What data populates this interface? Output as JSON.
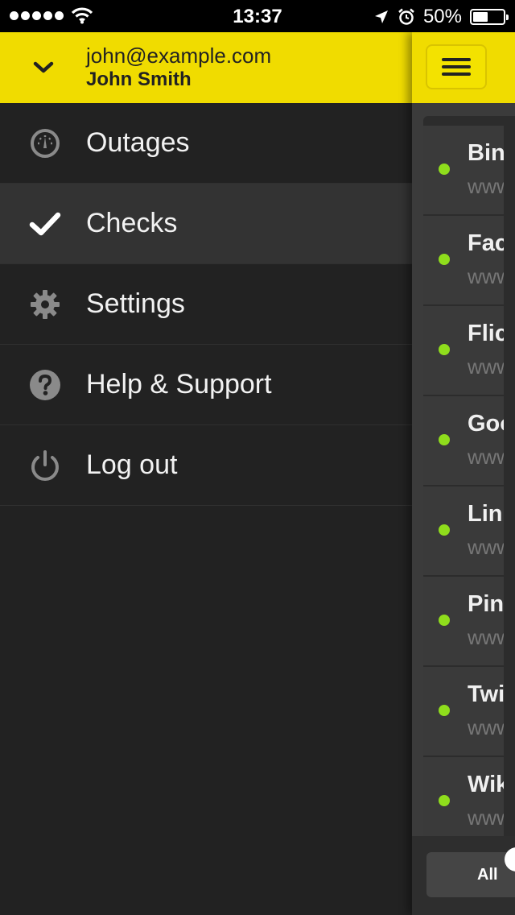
{
  "status_bar": {
    "time": "13:37",
    "battery": "50%",
    "icons": [
      "signal-dots",
      "wifi-icon",
      "location-arrow-icon",
      "alarm-icon",
      "battery-icon"
    ]
  },
  "drawer": {
    "account": {
      "email": "john@example.com",
      "name": "John Smith",
      "icon": "chevron-down-icon"
    },
    "menu": [
      {
        "label": "Outages",
        "icon": "dashboard-gauge-icon",
        "active": false
      },
      {
        "label": "Checks",
        "icon": "checkmark-icon",
        "active": true
      },
      {
        "label": "Settings",
        "icon": "gear-icon",
        "active": false
      },
      {
        "label": "Help & Support",
        "icon": "question-circle-icon",
        "active": false
      },
      {
        "label": "Log out",
        "icon": "power-icon",
        "active": false
      }
    ]
  },
  "main": {
    "menu_button_icon": "hamburger-icon",
    "checks": [
      {
        "name": "Bin",
        "url": "www"
      },
      {
        "name": "Fac",
        "url": "www"
      },
      {
        "name": "Flic",
        "url": "www"
      },
      {
        "name": "Goo",
        "url": "www"
      },
      {
        "name": "Lin",
        "url": "www"
      },
      {
        "name": "Pin",
        "url": "www"
      },
      {
        "name": "Twi",
        "url": "www"
      },
      {
        "name": "Wik",
        "url": "www"
      }
    ],
    "filter": {
      "label": "All"
    }
  },
  "colors": {
    "accent": "#f0dc00",
    "background": "#222222",
    "status_up": "#8fdd1c"
  }
}
